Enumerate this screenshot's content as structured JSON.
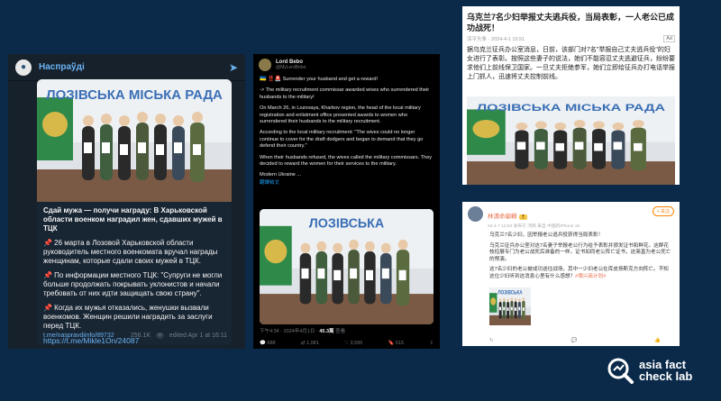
{
  "telegram": {
    "channel": "Наспраўді",
    "headline": "Сдай мужа — получи награду: В Харьковской области военком наградил жен, сдавших мужей в ТЦК",
    "para1": "📌 26 марта в Лозовой Харьковской области руководитель местного военкомата вручал награды женщинам, которые сдали своих мужей в ТЦК.",
    "para2": "📌 По информации местного ТЦК: \"Супруги не могли больше продолжать покрывать уклонистов и начали требовать от них идти защищать свою страну\".",
    "para3": "📌 Когда их мужья отказались, женушки вызвали военкомов. Женщин решили наградить за заслуги перед ТЦК.",
    "link": "https://t.me/Mikle1On/24087",
    "source": "t.me/naspravdiinfo/89732",
    "views": "256.1K",
    "edited": "edited  Apr 1 at 16:11",
    "photo_sign": "ЛОЗІВСЬКА МІСЬКА РАДА"
  },
  "x_post": {
    "name": "Lord Bebo",
    "handle": "@MyLordBebo",
    "flags": "🇺🇦 ‼️🚨",
    "line1": "Surrender your husband and get a reward!",
    "para1": "-> The military recruitment commissar awarded wives who surrendered their husbands to the military!",
    "para2": "On March 26, in Lozovaya, Kharkov region, the head of the local military registration and enlistment office presented awards to women who surrendered their husbands to the military recruitment.",
    "para3": "According to the local military recruitment: \"The wives could no longer continue to cover for the draft dodgers and began to demand that they go defend their country.\"",
    "para4": "When their husbands refused, the wives called the military commissars. They decided to reward the women for their services to the military.",
    "more": "Modern Ukraine ...",
    "translate": "翻譯帖文",
    "timestamp": "下午4:34 · 2024年4月1日 · ",
    "views_count": "45.3萬",
    "views_label": " 查看",
    "replies": "688",
    "reposts": "1,081",
    "likes": "3,595",
    "bookmarks": "515",
    "photo_sign": "ЛОЗІВСЬКА"
  },
  "article": {
    "title": "乌克兰7名少妇举报丈夫逃兵役，当局表彰，一人老公已成功战死！",
    "meta": "凉平头条 · 2024-4-1 15:51",
    "ad": "Ad",
    "body": "据乌克兰征兵办公室消息，日前，该部门对7名\"举报自己丈夫逃兵役\"的妇女进行了表彰。按照这些妻子的说法，她们不能容忍丈夫逃避征兵，纷纷要求他们上前线保卫国家。一旦丈夫拒绝参军，她们立即给征兵办打电话举报上门抓人，迅速将丈夫控制前线。",
    "photo_sign": "ЛОЗІВСЬКА МІСЬКА РАДА"
  },
  "weibo": {
    "name": "林濤命編輯",
    "badge": "🎖",
    "time": "24-4-7 12:53 发布于 河南 来自 中国的iPhone 16",
    "follow": "+ 关注",
    "para1": "乌克兰7名少妇，因举报老公逃兵役获得当局表彰！",
    "para2": "乌克兰征兵办公室对这7名妻子举报老公行为给予表彰并颁发证书和鲜花。这群花枝招展专门为老公战死后准备的一样。证书如同老公阵亡证书，这简直为老公死亡的预演。",
    "para3": "这7名少妇的老公被成功送往战场，其中一少妇老公在库皮扬斯克方向阵亡。不知这位少妇听到这消息心里有什么感想？",
    "tag": "#壕兴商计划#",
    "reposts": "",
    "comments": "",
    "likes": "",
    "photo_sign": "ЛОЗІВСЬКА"
  },
  "logo": {
    "line1": "asia fact",
    "line2": "check lab"
  }
}
